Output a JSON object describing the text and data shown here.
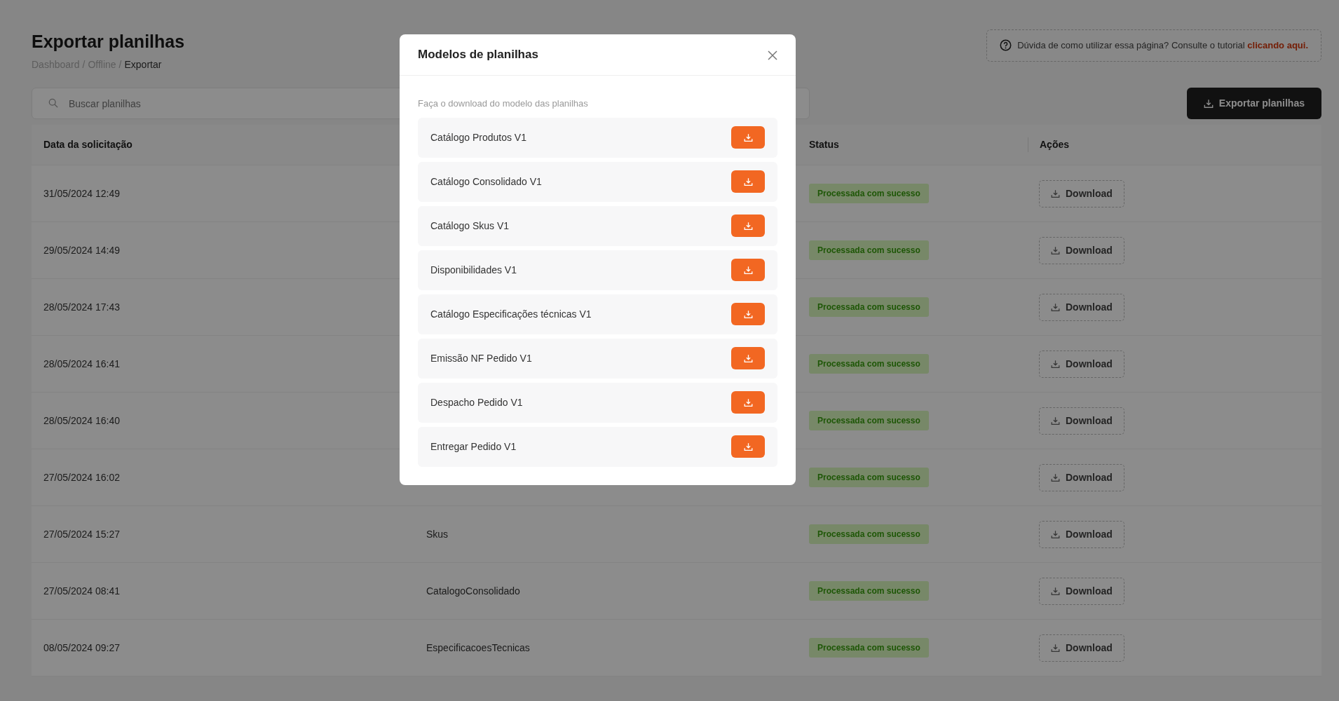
{
  "page": {
    "title": "Exportar planilhas",
    "separator": "/",
    "breadcrumb": [
      {
        "label": "Dashboard",
        "current": false
      },
      {
        "label": "Offline",
        "current": false
      },
      {
        "label": "Exportar",
        "current": true
      }
    ]
  },
  "help": {
    "text": "Dúvida de como utilizar essa página? Consulte o tutorial",
    "link": "clicando aqui."
  },
  "search": {
    "placeholder": "Buscar planilhas"
  },
  "export_button": "Exportar planilhas",
  "table": {
    "columns": {
      "date": "Data da solicitação",
      "status": "Status",
      "actions": "Ações"
    },
    "rows": [
      {
        "date": "31/05/2024 12:49",
        "status": "Processada com sucesso",
        "action": "Download"
      },
      {
        "date": "29/05/2024 14:49",
        "status": "Processada com sucesso",
        "action": "Download"
      },
      {
        "date": "28/05/2024 17:43",
        "status": "Processada com sucesso",
        "action": "Download"
      },
      {
        "date": "28/05/2024 16:41",
        "status": "Processada com sucesso",
        "action": "Download"
      },
      {
        "date": "28/05/2024 16:40",
        "status": "Processada com sucesso",
        "action": "Download"
      },
      {
        "date": "27/05/2024 16:02",
        "status": "Processada com sucesso",
        "action": "Download"
      },
      {
        "date": "27/05/2024 15:27",
        "type": "Skus",
        "status": "Processada com sucesso",
        "action": "Download"
      },
      {
        "date": "27/05/2024 08:41",
        "type": "CatalogoConsolidado",
        "status": "Processada com sucesso",
        "action": "Download"
      },
      {
        "date": "08/05/2024 09:27",
        "type": "EspecificacoesTecnicas",
        "status": "Processada com sucesso",
        "action": "Download"
      }
    ]
  },
  "modal": {
    "title": "Modelos de planilhas",
    "subtitle": "Faça o download do modelo das planilhas",
    "items": [
      {
        "label": "Catálogo Produtos V1"
      },
      {
        "label": "Catálogo Consolidado V1"
      },
      {
        "label": "Catálogo Skus V1"
      },
      {
        "label": "Disponibilidades V1"
      },
      {
        "label": "Catálogo Especificações técnicas V1"
      },
      {
        "label": "Emissão NF Pedido V1"
      },
      {
        "label": "Despacho Pedido V1"
      },
      {
        "label": "Entregar Pedido V1"
      }
    ]
  }
}
